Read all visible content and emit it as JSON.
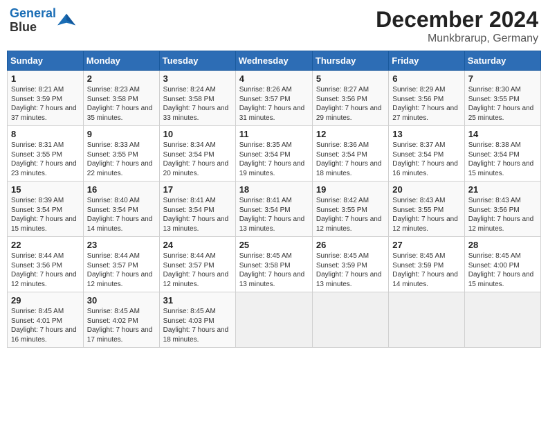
{
  "header": {
    "logo_line1": "General",
    "logo_line2": "Blue",
    "title": "December 2024",
    "subtitle": "Munkbrarup, Germany"
  },
  "days_of_week": [
    "Sunday",
    "Monday",
    "Tuesday",
    "Wednesday",
    "Thursday",
    "Friday",
    "Saturday"
  ],
  "weeks": [
    [
      {
        "day": "1",
        "info": "Sunrise: 8:21 AM\nSunset: 3:59 PM\nDaylight: 7 hours and 37 minutes."
      },
      {
        "day": "2",
        "info": "Sunrise: 8:23 AM\nSunset: 3:58 PM\nDaylight: 7 hours and 35 minutes."
      },
      {
        "day": "3",
        "info": "Sunrise: 8:24 AM\nSunset: 3:58 PM\nDaylight: 7 hours and 33 minutes."
      },
      {
        "day": "4",
        "info": "Sunrise: 8:26 AM\nSunset: 3:57 PM\nDaylight: 7 hours and 31 minutes."
      },
      {
        "day": "5",
        "info": "Sunrise: 8:27 AM\nSunset: 3:56 PM\nDaylight: 7 hours and 29 minutes."
      },
      {
        "day": "6",
        "info": "Sunrise: 8:29 AM\nSunset: 3:56 PM\nDaylight: 7 hours and 27 minutes."
      },
      {
        "day": "7",
        "info": "Sunrise: 8:30 AM\nSunset: 3:55 PM\nDaylight: 7 hours and 25 minutes."
      }
    ],
    [
      {
        "day": "8",
        "info": "Sunrise: 8:31 AM\nSunset: 3:55 PM\nDaylight: 7 hours and 23 minutes."
      },
      {
        "day": "9",
        "info": "Sunrise: 8:33 AM\nSunset: 3:55 PM\nDaylight: 7 hours and 22 minutes."
      },
      {
        "day": "10",
        "info": "Sunrise: 8:34 AM\nSunset: 3:54 PM\nDaylight: 7 hours and 20 minutes."
      },
      {
        "day": "11",
        "info": "Sunrise: 8:35 AM\nSunset: 3:54 PM\nDaylight: 7 hours and 19 minutes."
      },
      {
        "day": "12",
        "info": "Sunrise: 8:36 AM\nSunset: 3:54 PM\nDaylight: 7 hours and 18 minutes."
      },
      {
        "day": "13",
        "info": "Sunrise: 8:37 AM\nSunset: 3:54 PM\nDaylight: 7 hours and 16 minutes."
      },
      {
        "day": "14",
        "info": "Sunrise: 8:38 AM\nSunset: 3:54 PM\nDaylight: 7 hours and 15 minutes."
      }
    ],
    [
      {
        "day": "15",
        "info": "Sunrise: 8:39 AM\nSunset: 3:54 PM\nDaylight: 7 hours and 15 minutes."
      },
      {
        "day": "16",
        "info": "Sunrise: 8:40 AM\nSunset: 3:54 PM\nDaylight: 7 hours and 14 minutes."
      },
      {
        "day": "17",
        "info": "Sunrise: 8:41 AM\nSunset: 3:54 PM\nDaylight: 7 hours and 13 minutes."
      },
      {
        "day": "18",
        "info": "Sunrise: 8:41 AM\nSunset: 3:54 PM\nDaylight: 7 hours and 13 minutes."
      },
      {
        "day": "19",
        "info": "Sunrise: 8:42 AM\nSunset: 3:55 PM\nDaylight: 7 hours and 12 minutes."
      },
      {
        "day": "20",
        "info": "Sunrise: 8:43 AM\nSunset: 3:55 PM\nDaylight: 7 hours and 12 minutes."
      },
      {
        "day": "21",
        "info": "Sunrise: 8:43 AM\nSunset: 3:56 PM\nDaylight: 7 hours and 12 minutes."
      }
    ],
    [
      {
        "day": "22",
        "info": "Sunrise: 8:44 AM\nSunset: 3:56 PM\nDaylight: 7 hours and 12 minutes."
      },
      {
        "day": "23",
        "info": "Sunrise: 8:44 AM\nSunset: 3:57 PM\nDaylight: 7 hours and 12 minutes."
      },
      {
        "day": "24",
        "info": "Sunrise: 8:44 AM\nSunset: 3:57 PM\nDaylight: 7 hours and 12 minutes."
      },
      {
        "day": "25",
        "info": "Sunrise: 8:45 AM\nSunset: 3:58 PM\nDaylight: 7 hours and 13 minutes."
      },
      {
        "day": "26",
        "info": "Sunrise: 8:45 AM\nSunset: 3:59 PM\nDaylight: 7 hours and 13 minutes."
      },
      {
        "day": "27",
        "info": "Sunrise: 8:45 AM\nSunset: 3:59 PM\nDaylight: 7 hours and 14 minutes."
      },
      {
        "day": "28",
        "info": "Sunrise: 8:45 AM\nSunset: 4:00 PM\nDaylight: 7 hours and 15 minutes."
      }
    ],
    [
      {
        "day": "29",
        "info": "Sunrise: 8:45 AM\nSunset: 4:01 PM\nDaylight: 7 hours and 16 minutes."
      },
      {
        "day": "30",
        "info": "Sunrise: 8:45 AM\nSunset: 4:02 PM\nDaylight: 7 hours and 17 minutes."
      },
      {
        "day": "31",
        "info": "Sunrise: 8:45 AM\nSunset: 4:03 PM\nDaylight: 7 hours and 18 minutes."
      },
      null,
      null,
      null,
      null
    ]
  ]
}
